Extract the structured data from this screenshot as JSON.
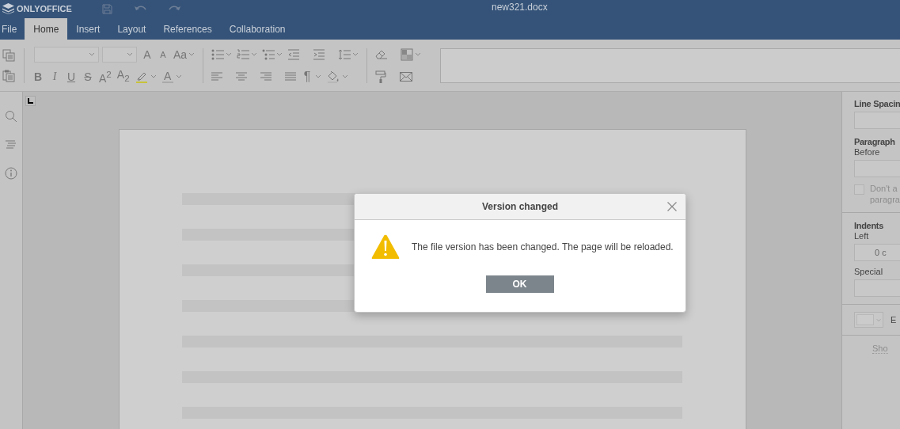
{
  "app": {
    "logo": "ONLYOFFICE",
    "document_title": "new321.docx"
  },
  "menu_tabs": [
    {
      "label": "File",
      "selected": false
    },
    {
      "label": "Home",
      "selected": true
    },
    {
      "label": "Insert",
      "selected": false
    },
    {
      "label": "Layout",
      "selected": false
    },
    {
      "label": "References",
      "selected": false
    },
    {
      "label": "Collaboration",
      "selected": false
    }
  ],
  "toolbar_glyphs": {
    "grow_font": "A",
    "shrink_font": "A",
    "change_case": "Aa",
    "bold": "B",
    "italic": "I",
    "underline": "U",
    "strikethrough": "S",
    "superscript": "A$^{2}$",
    "subscript": "A$_{2}$",
    "font_color": "A",
    "paragraph_mark": "¶"
  },
  "right_panel": {
    "line_spacing_label": "Line Spacin",
    "paragraph_spacing_label": "Paragraph",
    "before_label": "Before",
    "checkbox": {
      "lines": [
        "Don't a",
        "paragra"
      ],
      "checked": false
    },
    "indents_label": "Indents",
    "left_label": "Left",
    "left_value": "0 c",
    "special_label": "Special",
    "color_label": "E",
    "advanced_link": "Sho"
  },
  "dialog": {
    "title": "Version changed",
    "message": "The file version has been changed. The page will be reloaded.",
    "button": "OK"
  }
}
